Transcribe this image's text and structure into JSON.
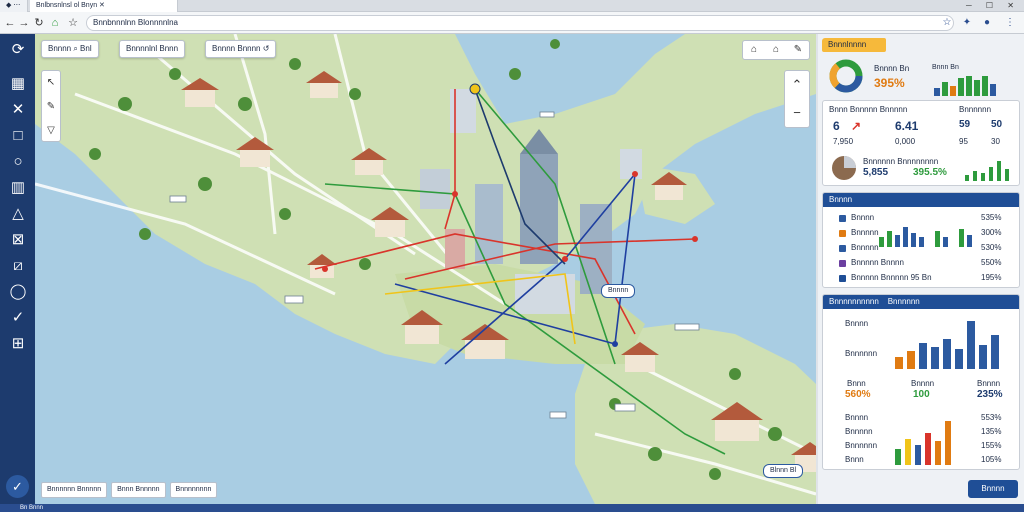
{
  "browser": {
    "tabs": [
      {
        "label": "◆ ⋯"
      },
      {
        "label": "Bnlbnsnlnsl ol Bnyn ✕"
      }
    ],
    "url": "Bnnbnnnlnn Blonnnnlna",
    "window_controls": "─ ☐ ✕"
  },
  "map": {
    "chips": [
      {
        "label": "Bnnnn ⌕ Bnl"
      },
      {
        "label": "Bnnnnlnl Bnnn"
      },
      {
        "label": "Bnnnn Bnnnn ↺"
      }
    ],
    "tags": [
      {
        "label": "Bnnnn"
      },
      {
        "label": "Blnnn Bl"
      }
    ],
    "bottom_buttons": [
      {
        "label": "Bnnnnnn Bnnnnn"
      },
      {
        "label": "Bnnn Bnnnnn"
      },
      {
        "label": "Bnnnnnnnn"
      }
    ],
    "route_colors": [
      "#1f3fa0",
      "#d9342b",
      "#2e9b3d",
      "#f0c419"
    ]
  },
  "panel": {
    "summary": {
      "header": "Bnnnlnnnn",
      "title": "Bnnnn Bn",
      "value": "395%",
      "small": "Bnnn Bn"
    },
    "kpis": {
      "header": "Bnnn Bnnnnn Bnnnnn",
      "right_header": "Bnnnnnn",
      "values": [
        {
          "a": "6",
          "b": "6.41",
          "c": "59",
          "d": "50"
        },
        {
          "a": "7,950",
          "b": "0,000",
          "c": "95",
          "d": "30"
        }
      ]
    },
    "trend": {
      "title": "Bnnnnnn Bnnnnnnnn",
      "left": "5,855",
      "right": "395.5%"
    },
    "list": {
      "header": "Bnnnn",
      "items": [
        {
          "label": "Bnnnn",
          "value": "535%",
          "color": "#2c5aa0"
        },
        {
          "label": "Bnnnnn",
          "value": "300%",
          "color": "#e07b12"
        },
        {
          "label": "Bnnnnn",
          "value": "530%",
          "color": "#2c5aa0"
        },
        {
          "label": "Bnnnnn Bnnnn",
          "value": "550%",
          "color": "#6b3fa0"
        },
        {
          "label": "Bnnnnn Bnnnnn 95 Bn",
          "value": "195%",
          "color": "#1f4e96"
        }
      ]
    },
    "chart1": {
      "header": "Bnnnnnnnnnn",
      "header2": "Bnnnnnn",
      "labels": [
        "Bnnnn",
        "Bnnnnnn"
      ],
      "bottom": [
        {
          "label": "Bnnn",
          "value": "560%"
        },
        {
          "label": "Bnnnn",
          "value": "100"
        },
        {
          "label": "Bnnnn",
          "value": "235%"
        }
      ]
    },
    "chart2": {
      "labels": [
        "Bnnnn",
        "Bnnnnn",
        "Bnnnnnn",
        "Bnnn"
      ],
      "values_right": [
        "553%",
        "135%",
        "155%",
        "105%"
      ]
    },
    "bottom_button": "Bnnnn"
  },
  "statusbar": {
    "text": "Bn  Bnnn"
  }
}
